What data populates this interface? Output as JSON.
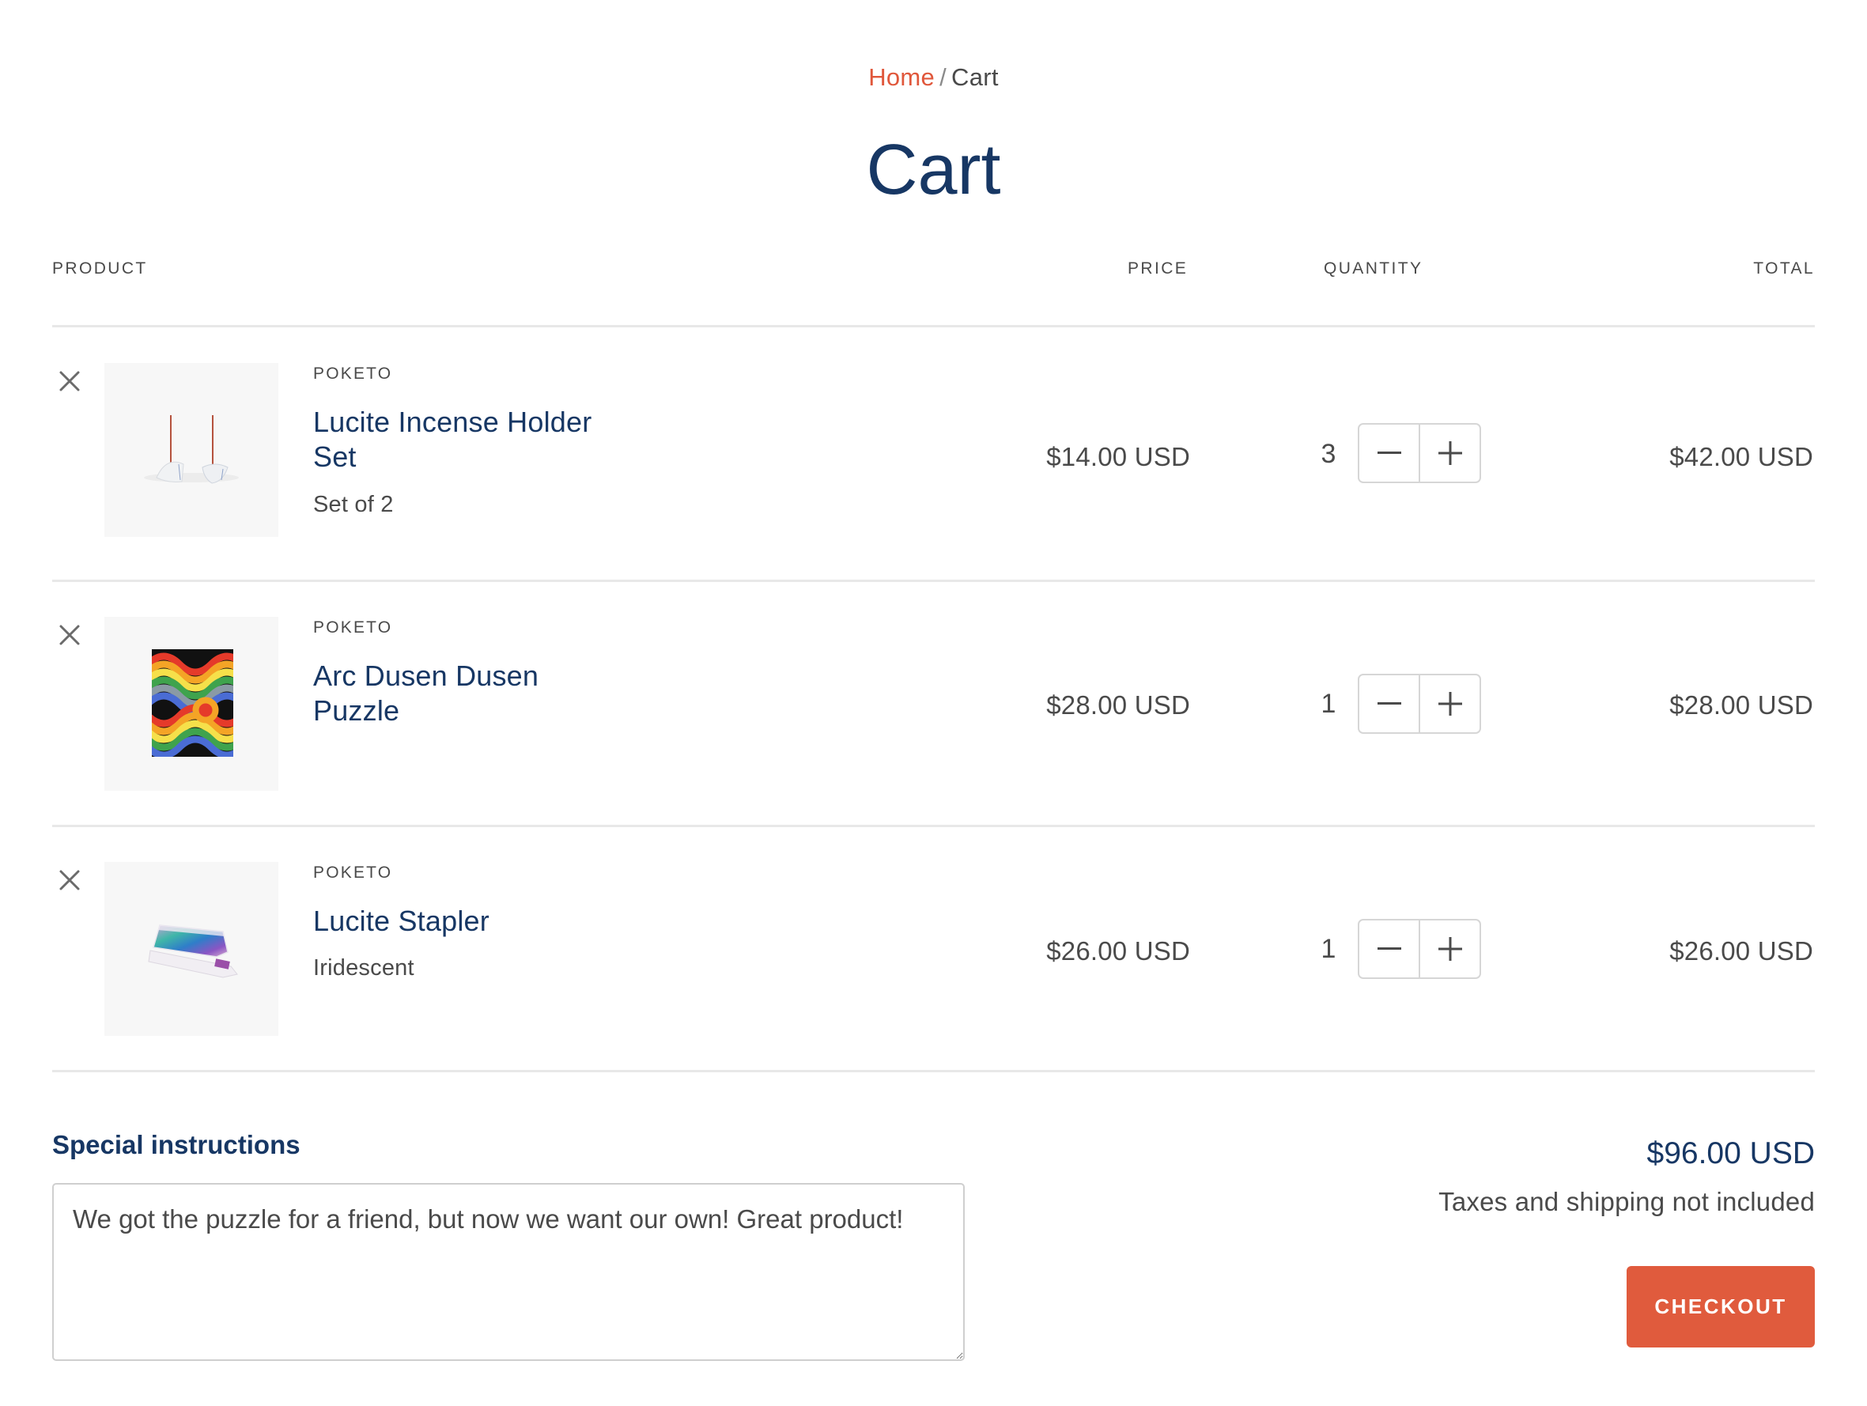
{
  "breadcrumb": {
    "home": "Home",
    "separator": "/",
    "current": "Cart"
  },
  "page_title": "Cart",
  "table": {
    "headers": {
      "product": "PRODUCT",
      "price": "PRICE",
      "quantity": "QUANTITY",
      "total": "TOTAL"
    },
    "items": [
      {
        "vendor": "POKETO",
        "title_line1": "Lucite Incense Holder",
        "title_line2": "Set",
        "variant": "Set of 2",
        "image": "incense-holder-image",
        "price": "$14.00 USD",
        "quantity": "3",
        "total": "$42.00 USD"
      },
      {
        "vendor": "POKETO",
        "title_line1": "Arc Dusen Dusen",
        "title_line2": "Puzzle",
        "variant": "",
        "image": "puzzle-image",
        "price": "$28.00 USD",
        "quantity": "1",
        "total": "$28.00 USD"
      },
      {
        "vendor": "POKETO",
        "title_line1": "Lucite Stapler",
        "title_line2": "",
        "variant": "Iridescent",
        "image": "stapler-image",
        "price": "$26.00 USD",
        "quantity": "1",
        "total": "$26.00 USD"
      }
    ]
  },
  "icons": {
    "remove": "close-icon",
    "decrease": "minus-icon",
    "increase": "plus-icon"
  },
  "instructions": {
    "label": "Special instructions",
    "value": "We got the puzzle for a friend, but now we want our own! Great product!"
  },
  "summary": {
    "subtotal": "$96.00 USD",
    "tax_note": "Taxes and shipping not included",
    "checkout_label": "CHECKOUT"
  },
  "colors": {
    "accent": "#e05b3d",
    "navy": "#173764",
    "text": "#4a4a4a",
    "border": "#d6d6d6",
    "divider": "#e8e8e8"
  }
}
